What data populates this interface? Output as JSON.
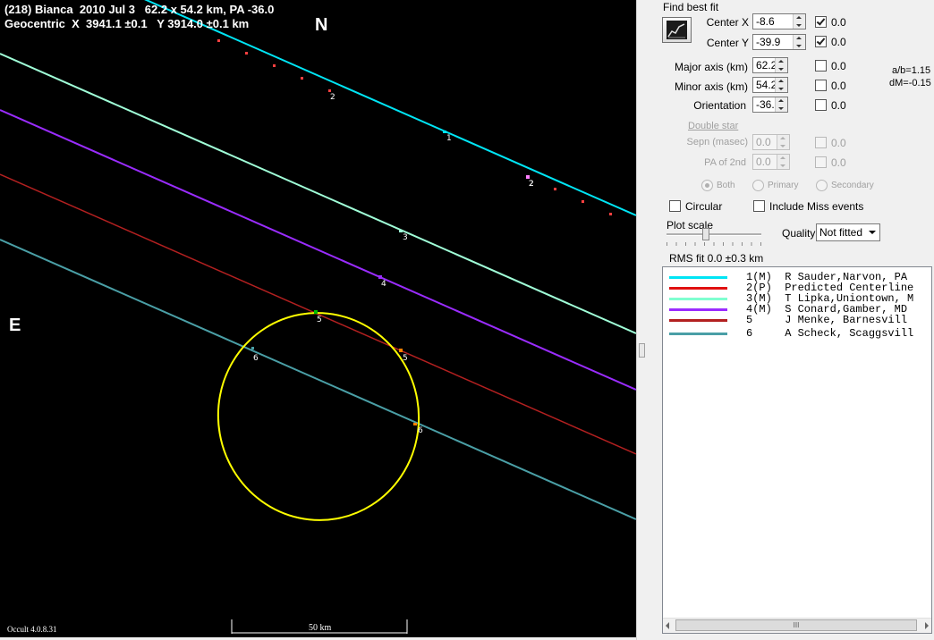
{
  "plot": {
    "title_line1": "(218) Bianca  2010 Jul 3   62.2 x 54.2 km, PA -36.0",
    "title_line2": "Geocentric  X  3941.1 ±0.1   Y 3914.0 ±0.1 km",
    "north_label": "N",
    "east_label": "E",
    "version": "Occult 4.0.8.31",
    "scale_label": "50 km",
    "ellipse_color": "#ffff00",
    "chords": [
      {
        "id": "1",
        "color": "#00e5f5"
      },
      {
        "id": "3",
        "color": "#a0ffd8"
      },
      {
        "id": "4",
        "color": "#9a2cff"
      },
      {
        "id": "5",
        "color": "#b32020"
      },
      {
        "id": "6",
        "color": "#4a9fa6"
      }
    ],
    "markers": [
      "2",
      "2",
      "1",
      "2",
      "3",
      "4",
      "5",
      "5",
      "6",
      "6"
    ]
  },
  "panel": {
    "find_best_fit": "Find best fit",
    "center_x": {
      "label": "Center X",
      "value": "-8.6",
      "checked": true,
      "offset": "0.0"
    },
    "center_y": {
      "label": "Center Y",
      "value": "-39.9",
      "checked": true,
      "offset": "0.0"
    },
    "major_axis": {
      "label": "Major axis (km)",
      "value": "62.2",
      "checked": false,
      "offset": "0.0"
    },
    "minor_axis": {
      "label": "Minor axis (km)",
      "value": "54.2",
      "checked": false,
      "offset": "0.0"
    },
    "orientation": {
      "label": "Orientation",
      "value": "-36.0",
      "checked": false,
      "offset": "0.0"
    },
    "ab_ratio": "a/b=1.15",
    "dm": "dM=-0.15",
    "double_star": "Double star",
    "sepn": {
      "label": "Sepn (masec)",
      "value": "0.0",
      "offset": "0.0"
    },
    "pa2nd": {
      "label": "PA of 2nd",
      "value": "0.0",
      "offset": "0.0"
    },
    "radio_both": "Both",
    "radio_primary": "Primary",
    "radio_secondary": "Secondary",
    "circular": "Circular",
    "include_miss": "Include Miss events",
    "plot_scale": "Plot scale",
    "quality_label": "Quality",
    "quality_value": "Not fitted",
    "rms_fit": "RMS fit 0.0 ±0.3 km"
  },
  "legend": [
    {
      "color": "#00e5f5",
      "text": "1(M)  R Sauder,Narvon, PA"
    },
    {
      "color": "#e01010",
      "text": "2(P)  Predicted Centerline"
    },
    {
      "color": "#80ffd0",
      "text": "3(M)  T Lipka,Uniontown, M"
    },
    {
      "color": "#9a2cff",
      "text": "4(M)  S Conard,Gamber, MD"
    },
    {
      "color": "#b32020",
      "text": "5     J Menke, Barnesvill"
    },
    {
      "color": "#4a9fa6",
      "text": "6     A Scheck, Scaggsvill"
    }
  ],
  "legend_scroll_grip": "III"
}
